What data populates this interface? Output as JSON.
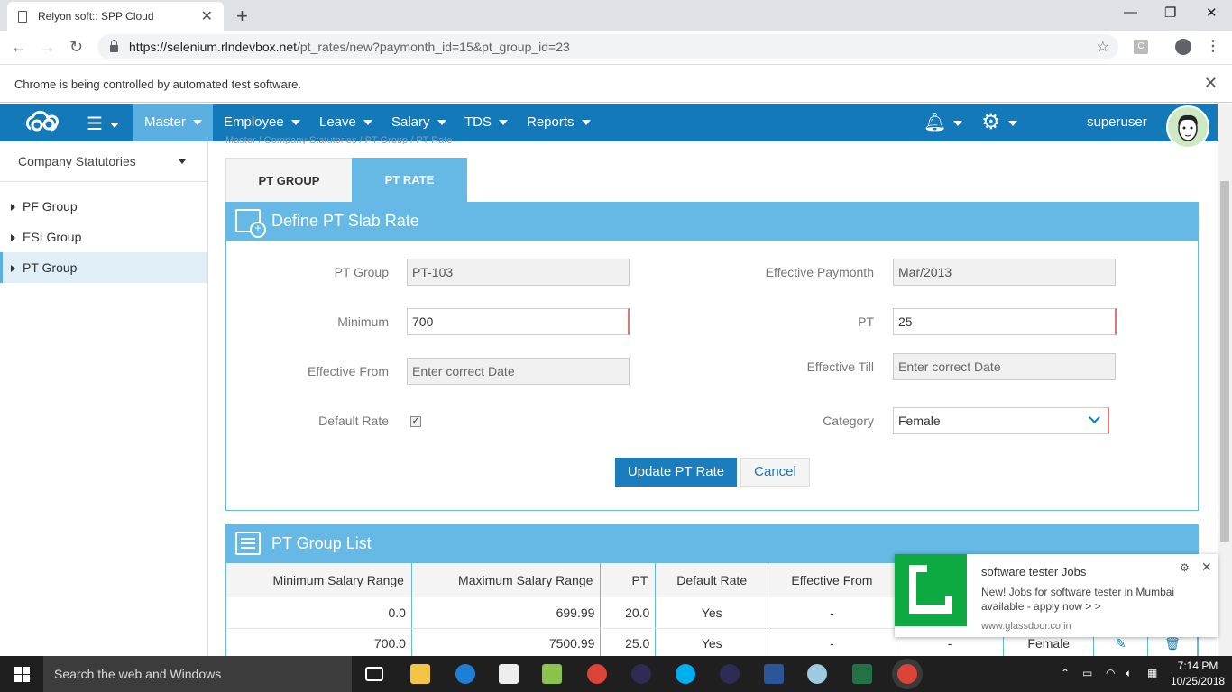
{
  "browser": {
    "tab_title": "Relyon soft:: SPP Cloud",
    "url_host": "https://selenium.rlndevbox.net",
    "url_path": "/pt_rates/new?paymonth_id=15&pt_group_id=23",
    "infobar_text": "Chrome is being controlled by automated test software."
  },
  "nav": {
    "items": [
      "Master",
      "Employee",
      "Leave",
      "Salary",
      "TDS",
      "Reports"
    ],
    "active": "Master",
    "username": "superuser"
  },
  "breadcrumb": "Master  /  Company Statutories  /  PT Group  /  PT Rate",
  "sidebar": {
    "heading": "Company Statutories",
    "items": [
      {
        "label": "PF Group"
      },
      {
        "label": "ESI Group"
      },
      {
        "label": "PT Group",
        "active": true
      }
    ]
  },
  "tabs": {
    "group": "PT GROUP",
    "rate": "PT RATE"
  },
  "form": {
    "title": "Define PT Slab Rate",
    "pt_group_label": "PT Group",
    "pt_group_value": "PT-103",
    "eff_paymonth_label": "Effective Paymonth",
    "eff_paymonth_value": "Mar/2013",
    "minimum_label": "Minimum",
    "minimum_value": "700",
    "pt_label": "PT",
    "pt_value": "25",
    "eff_from_label": "Effective From",
    "eff_from_placeholder": "Enter correct Date",
    "eff_till_label": "Effective Till",
    "eff_till_placeholder": "Enter correct Date",
    "default_rate_label": "Default Rate",
    "default_rate_checked": true,
    "category_label": "Category",
    "category_value": "Female",
    "submit_label": "Update PT Rate",
    "cancel_label": "Cancel"
  },
  "list": {
    "title": "PT Group List",
    "columns": [
      "Minimum Salary Range",
      "Maximum Salary Range",
      "PT",
      "Default Rate",
      "Effective From"
    ],
    "rows": [
      [
        "0.0",
        "699.99",
        "20.0",
        "Yes",
        "-"
      ],
      [
        "700.0",
        "7500.99",
        "25.0",
        "Yes",
        "-",
        "-",
        "Female"
      ]
    ]
  },
  "toast": {
    "title": "software tester Jobs",
    "body": "New! Jobs for software tester in Mumbai available - apply now > >",
    "source": "www.glassdoor.co.in",
    "brand_color": "#0caa41"
  },
  "taskbar": {
    "search_placeholder": "Search the web and Windows",
    "time": "7:14 PM",
    "date": "10/25/2018"
  },
  "colors": {
    "navbar": "#1479b8",
    "accent": "#66b9e4",
    "primary_button": "#1a7dbd"
  }
}
